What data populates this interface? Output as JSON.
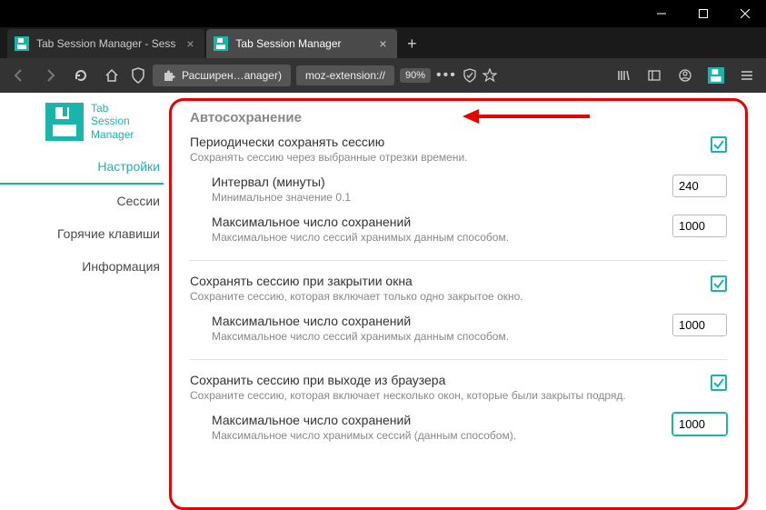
{
  "window": {
    "title": ""
  },
  "tabs": [
    {
      "title": "Tab Session Manager - Sess",
      "active": false
    },
    {
      "title": "Tab Session Manager",
      "active": true
    }
  ],
  "urlbar": {
    "extension_label": "Расширен…anager)",
    "url_text": "moz-extension://",
    "zoom": "90%"
  },
  "sidebar": {
    "app_name_lines": [
      "Tab",
      "Session",
      "Manager"
    ],
    "items": [
      {
        "label": "Настройки",
        "active": true
      },
      {
        "label": "Сессии",
        "active": false
      },
      {
        "label": "Горячие клавиши",
        "active": false
      },
      {
        "label": "Информация",
        "active": false
      }
    ]
  },
  "section": {
    "title": "Автосохранение",
    "groups": [
      {
        "label": "Периодически сохранять сессию",
        "desc": "Сохранять сессию через выбранные отрезки времени.",
        "checked": true,
        "subs": [
          {
            "label": "Интервал (минуты)",
            "desc": "Минимальное значение 0.1",
            "value": "240"
          },
          {
            "label": "Максимальное число сохранений",
            "desc": "Максимальное число сессий хранимых данным способом.",
            "value": "1000"
          }
        ]
      },
      {
        "label": "Сохранять сессию при закрытии окна",
        "desc": "Сохраните сессию, которая включает только одно закрытое окно.",
        "checked": true,
        "subs": [
          {
            "label": "Максимальное число сохранений",
            "desc": "Максимальное число сессий хранимых данным способом.",
            "value": "1000"
          }
        ]
      },
      {
        "label": "Сохранить сессию при выходе из браузера",
        "desc": "Сохраните сессию, которая включает несколько окон, которые были закрыты подряд.",
        "checked": true,
        "subs": [
          {
            "label": "Максимальное число сохранений",
            "desc": "Максимальное число хранимых сессий (данным способом).",
            "value": "1000",
            "focused": true
          }
        ]
      }
    ]
  },
  "colors": {
    "accent": "#19b5ab",
    "annotation": "#e60000"
  }
}
